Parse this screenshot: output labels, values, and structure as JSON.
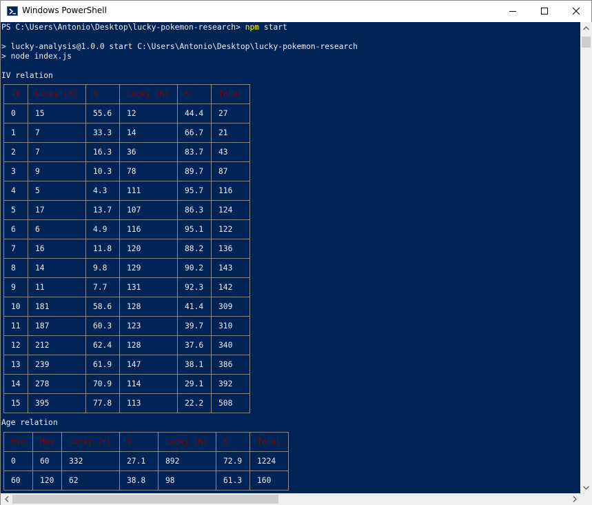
{
  "window": {
    "title": "Windows PowerShell",
    "icon": "powershell-icon",
    "controls": [
      "minimize-icon",
      "maximize-icon",
      "close-icon"
    ]
  },
  "console": {
    "prompt": "PS C:\\Users\\Antonio\\Desktop\\lucky-pokemon-research> ",
    "command_name": "npm",
    "command_args": " start",
    "output_line1": "> lucky-analysis@1.0.0 start C:\\Users\\Antonio\\Desktop\\lucky-pokemon-research",
    "output_line2": "> node index.js",
    "section1_title": "IV relation",
    "section2_title": "Age relation",
    "colors": {
      "background": "#012456",
      "text": "#eeedf0",
      "command": "#ffff00",
      "header": "#8b0000"
    }
  },
  "iv_table": {
    "headers": [
      "IV",
      "Lucky (Y)",
      "%",
      "Lucky (N)",
      "%",
      "Total"
    ],
    "rows": [
      [
        "0",
        "15",
        "55.6",
        "12",
        "44.4",
        "27"
      ],
      [
        "1",
        "7",
        "33.3",
        "14",
        "66.7",
        "21"
      ],
      [
        "2",
        "7",
        "16.3",
        "36",
        "83.7",
        "43"
      ],
      [
        "3",
        "9",
        "10.3",
        "78",
        "89.7",
        "87"
      ],
      [
        "4",
        "5",
        "4.3",
        "111",
        "95.7",
        "116"
      ],
      [
        "5",
        "17",
        "13.7",
        "107",
        "86.3",
        "124"
      ],
      [
        "6",
        "6",
        "4.9",
        "116",
        "95.1",
        "122"
      ],
      [
        "7",
        "16",
        "11.8",
        "120",
        "88.2",
        "136"
      ],
      [
        "8",
        "14",
        "9.8",
        "129",
        "90.2",
        "143"
      ],
      [
        "9",
        "11",
        "7.7",
        "131",
        "92.3",
        "142"
      ],
      [
        "10",
        "181",
        "58.6",
        "128",
        "41.4",
        "309"
      ],
      [
        "11",
        "187",
        "60.3",
        "123",
        "39.7",
        "310"
      ],
      [
        "12",
        "212",
        "62.4",
        "128",
        "37.6",
        "340"
      ],
      [
        "13",
        "239",
        "61.9",
        "147",
        "38.1",
        "386"
      ],
      [
        "14",
        "278",
        "70.9",
        "114",
        "29.1",
        "392"
      ],
      [
        "15",
        "395",
        "77.8",
        "113",
        "22.2",
        "508"
      ]
    ]
  },
  "age_table": {
    "headers": [
      "Min",
      "Max",
      "Lucky (Y)",
      "%",
      "Lucky (N)",
      "%",
      "Total"
    ],
    "rows": [
      [
        "0",
        "60",
        "332",
        "27.1",
        "892",
        "72.9",
        "1224"
      ],
      [
        "60",
        "120",
        "62",
        "38.8",
        "98",
        "61.3",
        "160"
      ]
    ]
  },
  "scrollbars": {
    "vertical_icons": [
      "arrow-up-icon",
      "arrow-down-icon"
    ],
    "horizontal_icons": [
      "arrow-left-icon",
      "arrow-right-icon"
    ]
  }
}
